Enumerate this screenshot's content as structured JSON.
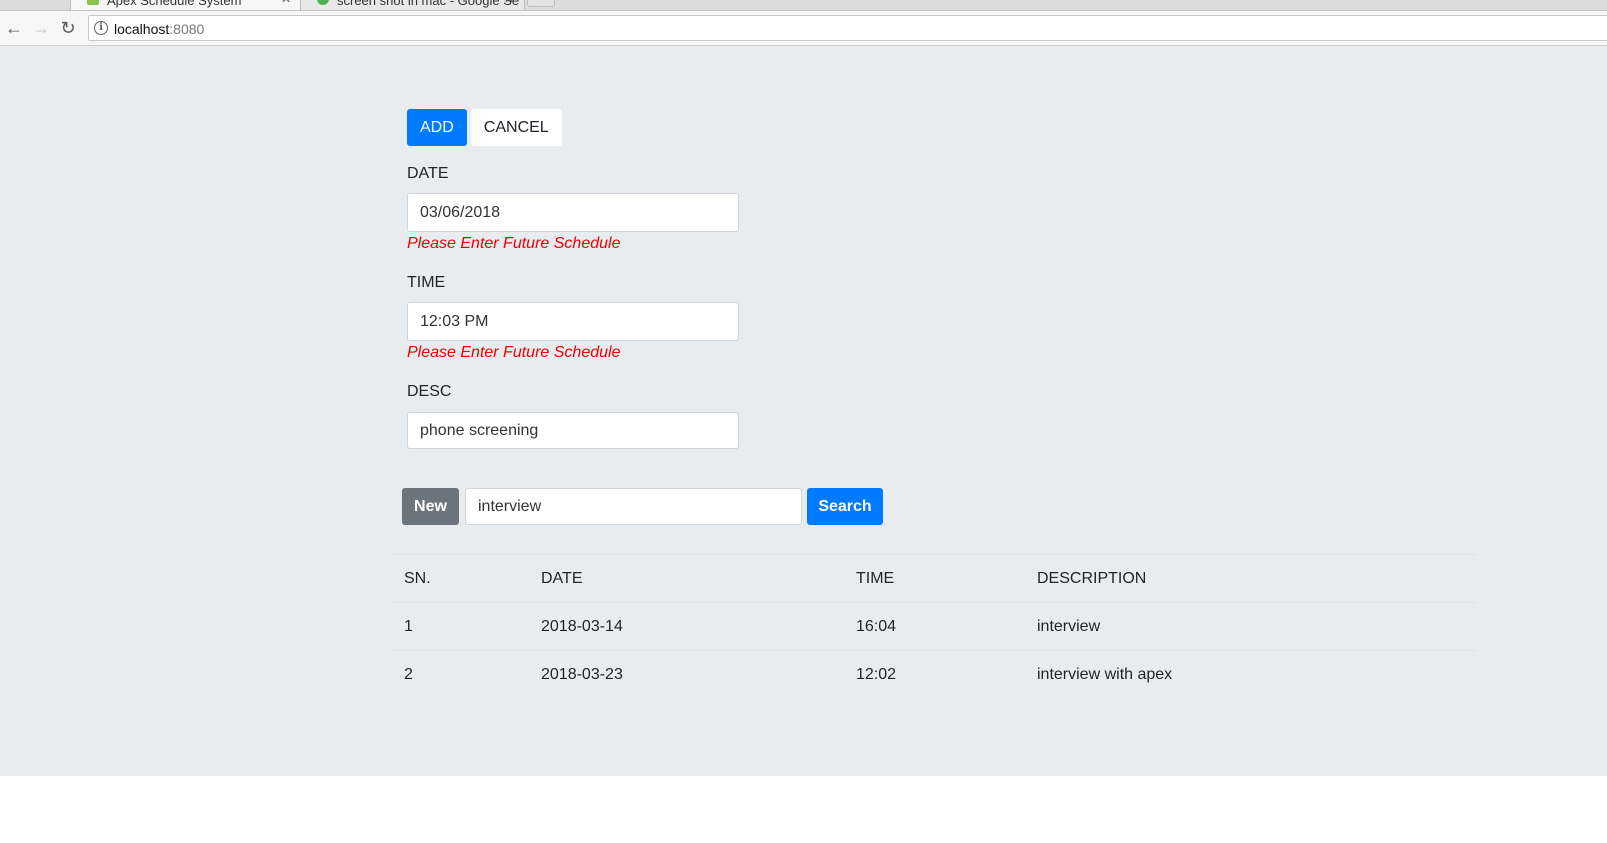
{
  "browser": {
    "tabs": [
      {
        "title": "Apex Schedule System",
        "active": true,
        "favicon_color": "#8bc34a"
      },
      {
        "title": "screen shot in mac - Google Se",
        "active": false,
        "favicon_color": "#4caf50"
      }
    ],
    "url_host": "localhost",
    "url_port": ":8080"
  },
  "form": {
    "add_label": "ADD",
    "cancel_label": "CANCEL",
    "date_label": "DATE",
    "date_value": "03/06/2018",
    "date_error": "Please Enter Future Schedule",
    "time_label": "TIME",
    "time_value": "12:03 PM",
    "time_error": "Please Enter Future Schedule",
    "desc_label": "DESC",
    "desc_value": "phone screening"
  },
  "search": {
    "new_label": "New",
    "query": "interview",
    "search_label": "Search"
  },
  "table": {
    "headers": [
      "SN.",
      "DATE",
      "TIME",
      "DESCRIPTION"
    ],
    "rows": [
      [
        "1",
        "2018-03-14",
        "16:04",
        "interview"
      ],
      [
        "2",
        "2018-03-23",
        "12:02",
        "interview with apex"
      ]
    ]
  },
  "colors": {
    "primary": "#007bff",
    "secondary": "#6c757d",
    "error": "#ee0000",
    "page_bg": "#e9ecef"
  }
}
